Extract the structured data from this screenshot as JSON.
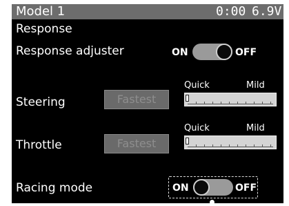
{
  "titlebar": {
    "model": "Model 1",
    "timer": "0:00",
    "voltage": "6.9V"
  },
  "section_title": "Response",
  "response_adjuster": {
    "label": "Response adjuster",
    "on_label": "ON",
    "off_label": "OFF",
    "state": "ON"
  },
  "steering": {
    "label": "Steering",
    "button_label": "Fastest",
    "scale_left": "Quick",
    "scale_right": "Mild",
    "level": 0
  },
  "throttle": {
    "label": "Throttle",
    "button_label": "Fastest",
    "scale_left": "Quick",
    "scale_right": "Mild",
    "level": 0
  },
  "racing_mode": {
    "label": "Racing mode",
    "on_label": "ON",
    "off_label": "OFF",
    "state": "OFF"
  }
}
